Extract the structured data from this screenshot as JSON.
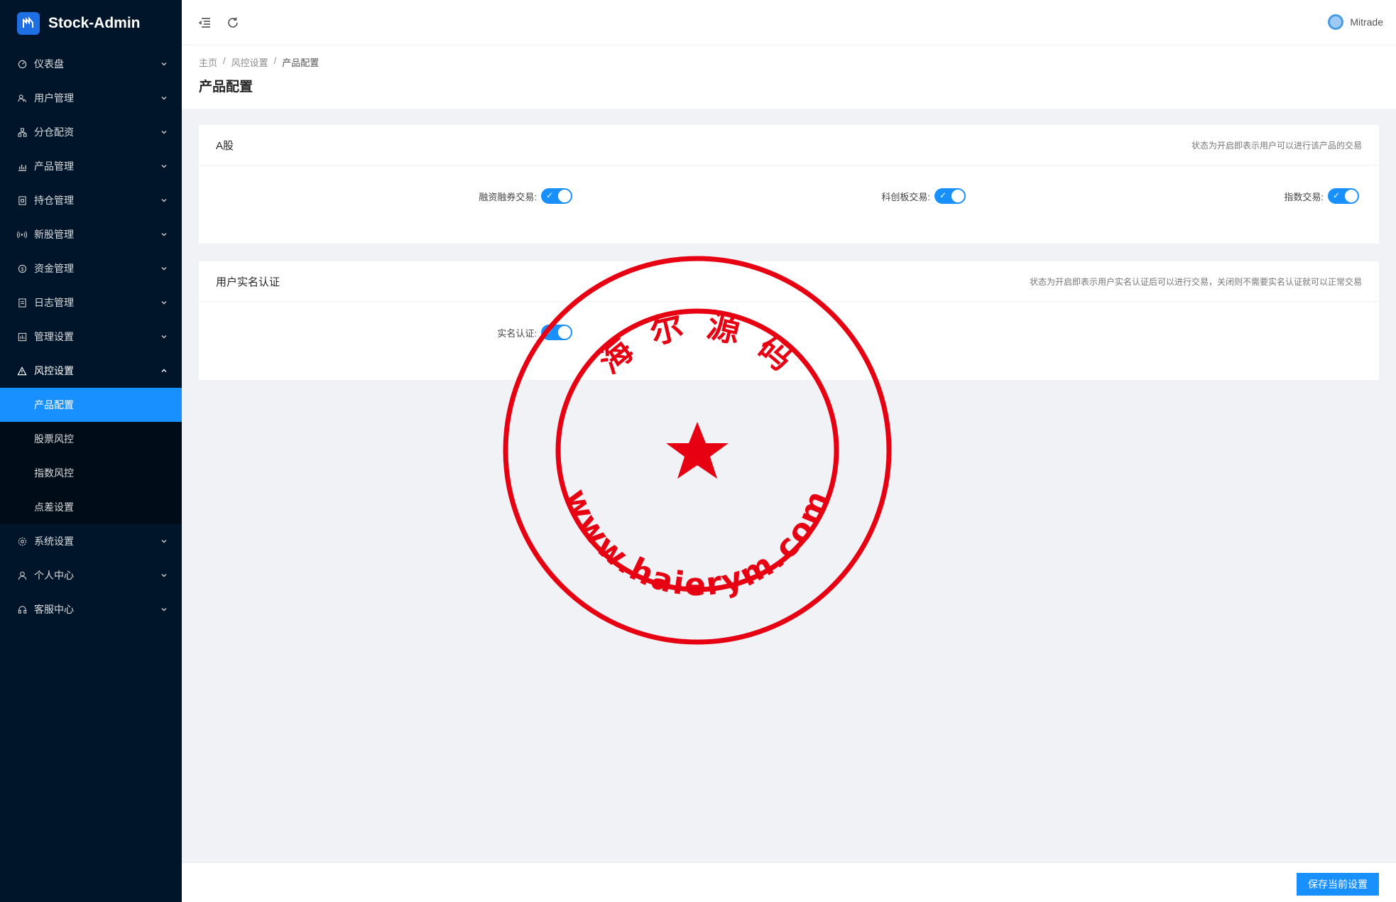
{
  "app": {
    "title": "Stock-Admin"
  },
  "sidebar": {
    "items": [
      {
        "label": "仪表盘",
        "icon": "dashboard-icon"
      },
      {
        "label": "用户管理",
        "icon": "users-icon"
      },
      {
        "label": "分仓配资",
        "icon": "cluster-icon"
      },
      {
        "label": "产品管理",
        "icon": "chart-icon"
      },
      {
        "label": "持仓管理",
        "icon": "position-icon"
      },
      {
        "label": "新股管理",
        "icon": "signal-icon"
      },
      {
        "label": "资金管理",
        "icon": "money-icon"
      },
      {
        "label": "日志管理",
        "icon": "log-icon"
      },
      {
        "label": "管理设置",
        "icon": "admin-icon"
      },
      {
        "label": "风控设置",
        "icon": "warning-icon"
      },
      {
        "label": "系统设置",
        "icon": "gear-icon"
      },
      {
        "label": "个人中心",
        "icon": "user-icon"
      },
      {
        "label": "客服中心",
        "icon": "headset-icon"
      }
    ],
    "open_submenu": [
      {
        "label": "产品配置"
      },
      {
        "label": "股票风控"
      },
      {
        "label": "指数风控"
      },
      {
        "label": "点差设置"
      }
    ]
  },
  "header": {
    "username": "Mitrade"
  },
  "breadcrumb": {
    "home": "主页",
    "parent": "风控设置",
    "current": "产品配置",
    "sep": "/"
  },
  "page": {
    "title": "产品配置"
  },
  "cards": {
    "a_share": {
      "title": "A股",
      "hint": "状态为开启即表示用户可以进行该产品的交易",
      "fields": [
        {
          "label": "融资融券交易:",
          "on": true
        },
        {
          "label": "科创板交易:",
          "on": true
        },
        {
          "label": "指数交易:",
          "on": true
        }
      ]
    },
    "realname": {
      "title": "用户实名认证",
      "hint": "状态为开启即表示用户实名认证后可以进行交易，关闭则不需要实名认证就可以正常交易",
      "fields": [
        {
          "label": "实名认证:",
          "on": true
        }
      ]
    }
  },
  "footer": {
    "save_label": "保存当前设置"
  },
  "watermark": {
    "top_text": "海 尔 源 码",
    "bottom_text": "www.haierym.com",
    "color": "#e60012"
  },
  "colors": {
    "sidebar_bg": "#001529",
    "accent": "#1890ff"
  }
}
